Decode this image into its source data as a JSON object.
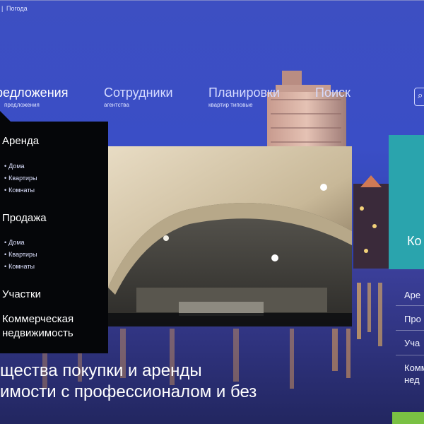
{
  "topbar": {
    "separator": "|",
    "weather_link": "Погода"
  },
  "nav": {
    "items": [
      {
        "main": "редложения",
        "sub": "предложения"
      },
      {
        "main": "Сотрудники",
        "sub": "агентства"
      },
      {
        "main": "Планировки",
        "sub": "квартир типовые"
      },
      {
        "main": "Поиск",
        "sub": ""
      }
    ],
    "search_icon": "search-icon"
  },
  "submenu": {
    "rent": {
      "title": "Аренда",
      "items": [
        "Дома",
        "Квартиры",
        "Комнаты"
      ]
    },
    "sale": {
      "title": "Продажа",
      "items": [
        "Дома",
        "Квартиры",
        "Комнаты"
      ]
    },
    "plots": {
      "title": "Участки"
    },
    "commercial": {
      "line1": "Коммерческая",
      "line2": "недвижимость"
    }
  },
  "side_panel": {
    "teal_text": "Ко",
    "links": [
      "Аре",
      "Про",
      "Уча",
      "Комм",
      "нед"
    ]
  },
  "headline": {
    "line1": "щества покупки и аренды",
    "line2": "имости с профессионалом и без"
  },
  "colors": {
    "teal": "#2aa4ad",
    "green": "#7ac143",
    "submenu_bg": "#050609"
  }
}
